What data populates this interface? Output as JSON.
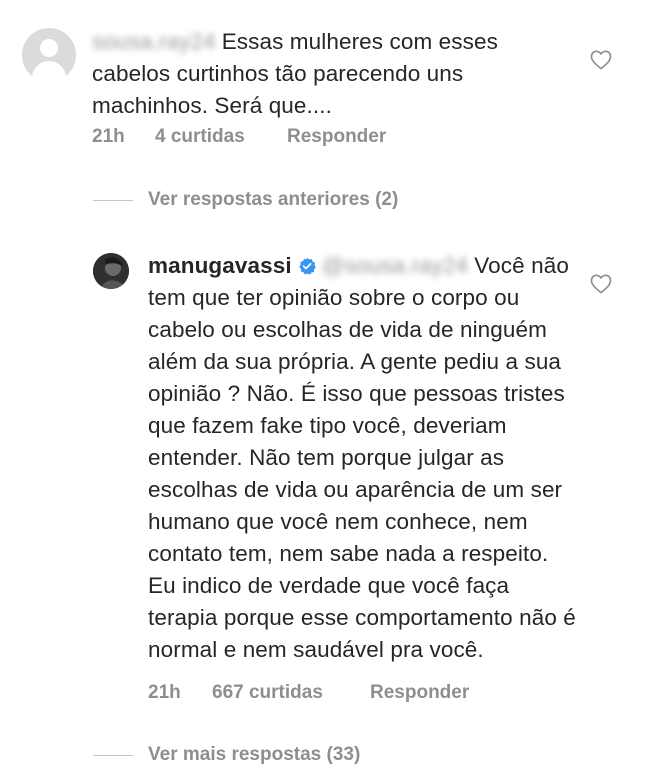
{
  "comment1": {
    "username": "sousa.ray24",
    "text": "Essas mulheres com esses cabelos curtinhos tão parecendo uns machinhos. Será que....",
    "time": "21h",
    "likes": "4 curtidas",
    "reply": "Responder"
  },
  "thread": {
    "view_previous": "Ver respostas anteriores (2)",
    "view_more": "Ver mais respostas (33)"
  },
  "comment2": {
    "username": "manugavassi",
    "mention": "@sousa.ray24",
    "text": "Você não tem que ter opinião sobre o corpo ou cabelo ou escolhas de vida de ninguém além da sua própria. A gente pediu a sua opinião ? Não. É isso que pessoas tristes que fazem fake tipo você, deveriam entender. Não tem porque julgar as escolhas de vida ou aparência de um ser humano que você nem conhece, nem contato tem, nem sabe nada a respeito. Eu indico de verdade que você faça terapia porque esse comportamento não é normal e nem saudável pra você.",
    "time": "21h",
    "likes": "667 curtidas",
    "reply": "Responder"
  },
  "colors": {
    "text": "#262626",
    "secondary": "#8e8e8e",
    "verified": "#3897f0",
    "divider": "#c7c7c7"
  },
  "icons": {
    "avatar": "default-avatar-icon",
    "heart": "heart-outline-icon",
    "verified": "verified-badge-icon"
  }
}
